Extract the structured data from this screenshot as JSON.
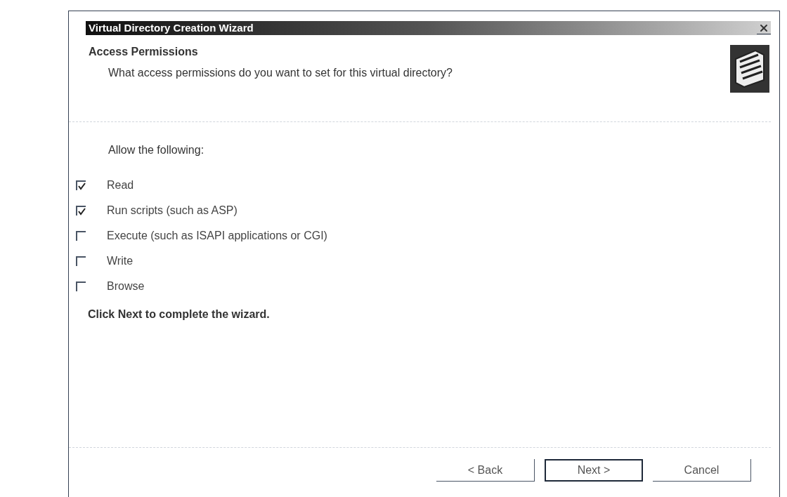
{
  "window": {
    "title": "Virtual Directory Creation Wizard"
  },
  "header": {
    "title": "Access Permissions",
    "subtitle": "What access permissions do you want to set for this virtual directory?"
  },
  "intro": "Allow the following:",
  "permissions": [
    {
      "label": "Read",
      "checked": true
    },
    {
      "label": "Run scripts (such as ASP)",
      "checked": true
    },
    {
      "label": "Execute (such as ISAPI applications or CGI)",
      "checked": false
    },
    {
      "label": "Write",
      "checked": false
    },
    {
      "label": "Browse",
      "checked": false
    }
  ],
  "footer_note": "Click Next to complete the wizard.",
  "buttons": [
    {
      "label": "< Back",
      "focused": false
    },
    {
      "label": "Next >",
      "focused": true
    },
    {
      "label": "Cancel",
      "focused": false
    }
  ]
}
